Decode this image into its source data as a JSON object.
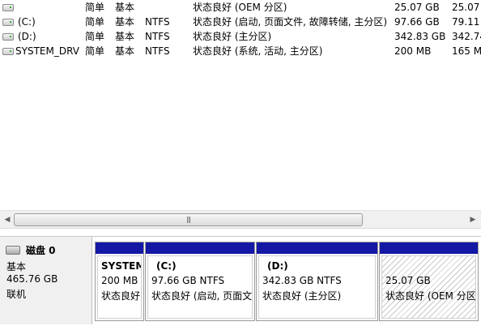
{
  "volumes": [
    {
      "name": "",
      "layout": "简单",
      "type": "基本",
      "fs": "",
      "status": "状态良好 (OEM 分区)",
      "capacity": "25.07 GB",
      "free": "25.07"
    },
    {
      "name": "(C:)",
      "layout": "简单",
      "type": "基本",
      "fs": "NTFS",
      "status": "状态良好 (启动, 页面文件, 故障转储, 主分区)",
      "capacity": "97.66 GB",
      "free": "79.11"
    },
    {
      "name": "(D:)",
      "layout": "简单",
      "type": "基本",
      "fs": "NTFS",
      "status": "状态良好 (主分区)",
      "capacity": "342.83 GB",
      "free": "342.74"
    },
    {
      "name": "SYSTEM_DRV",
      "layout": "简单",
      "type": "基本",
      "fs": "NTFS",
      "status": "状态良好 (系统, 活动, 主分区)",
      "capacity": "200 MB",
      "free": "165 M"
    }
  ],
  "scrollbar": {
    "left_arrow": "◀",
    "right_arrow": "▶",
    "grip": "|||",
    "thumb_fraction": 0.77
  },
  "disk": {
    "title": "磁盘 0",
    "type": "基本",
    "size": "465.76 GB",
    "state": "联机"
  },
  "partitions": [
    {
      "label": "SYSTEM",
      "size": "200 MB",
      "status": "状态良好"
    },
    {
      "label": "(C:)",
      "size": "97.66 GB NTFS",
      "status": "状态良好 (启动, 页面文"
    },
    {
      "label": "(D:)",
      "size": "342.83 GB NTFS",
      "status": "状态良好 (主分区)"
    },
    {
      "label": "",
      "size": "25.07 GB",
      "status": "状态良好 (OEM 分区"
    }
  ],
  "colors": {
    "partition_bar": "#1418a5",
    "panel_bg": "#f0f0f0"
  }
}
